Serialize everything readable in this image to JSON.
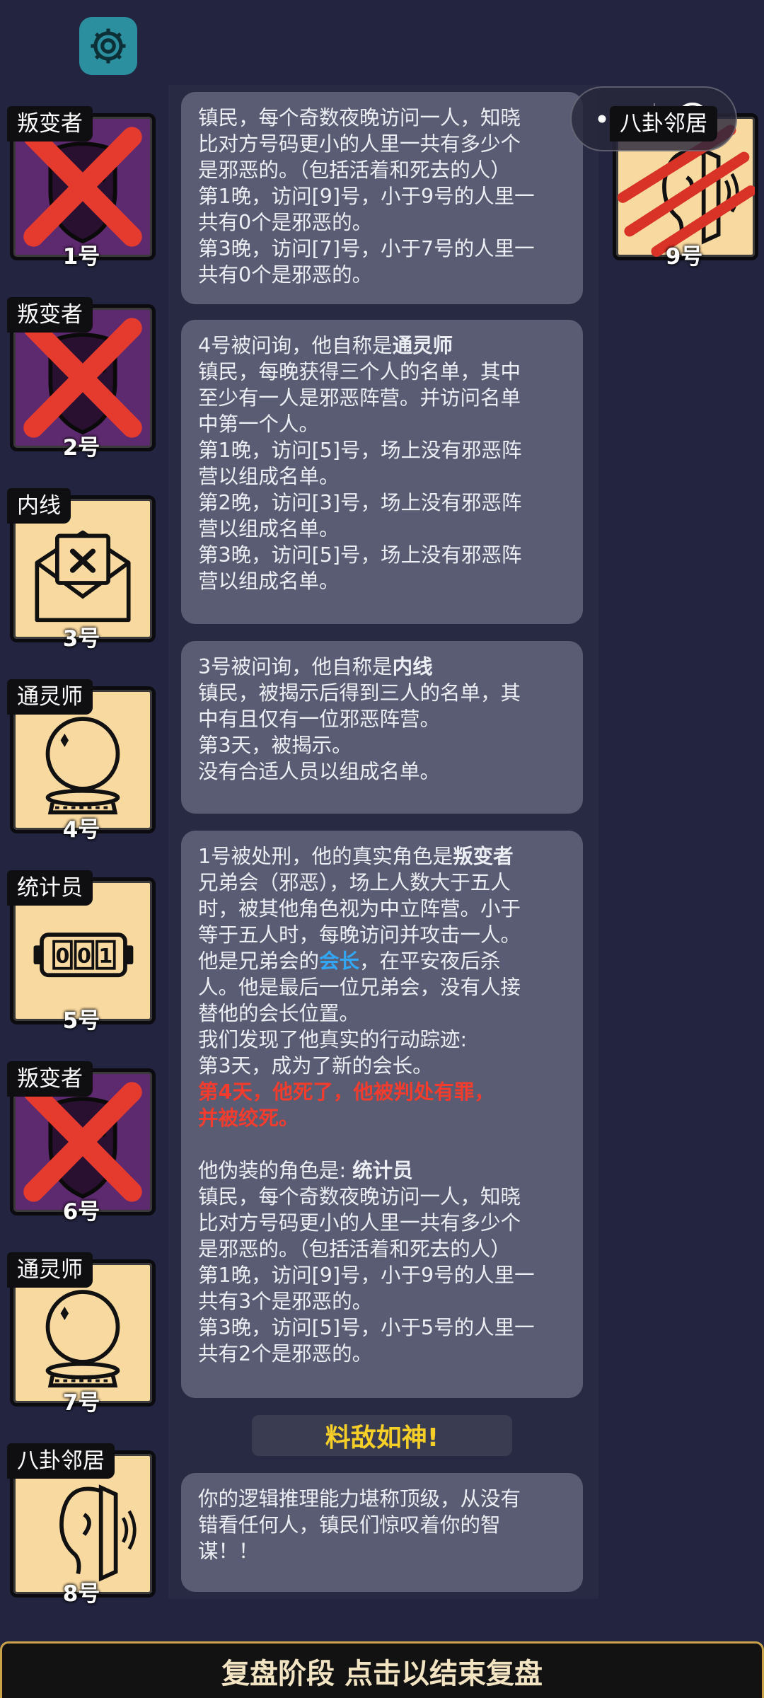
{
  "settings": {
    "icon": "gear-icon"
  },
  "players": [
    {
      "label": "叛变者",
      "number": "1号",
      "style": "purple",
      "dead": true,
      "icon": "mask-icon"
    },
    {
      "label": "叛变者",
      "number": "2号",
      "style": "purple",
      "dead": true,
      "icon": "mask-icon"
    },
    {
      "label": "内线",
      "number": "3号",
      "style": "tan",
      "dead": false,
      "icon": "envelope-icon"
    },
    {
      "label": "通灵师",
      "number": "4号",
      "style": "tan",
      "dead": false,
      "icon": "crystal-ball-icon"
    },
    {
      "label": "统计员",
      "number": "5号",
      "style": "tan",
      "dead": false,
      "icon": "counter-icon"
    },
    {
      "label": "叛变者",
      "number": "6号",
      "style": "purple",
      "dead": true,
      "icon": "mask-icon"
    },
    {
      "label": "通灵师",
      "number": "7号",
      "style": "tan",
      "dead": false,
      "icon": "crystal-ball-icon"
    },
    {
      "label": "八卦邻居",
      "number": "8号",
      "style": "tan",
      "dead": false,
      "icon": "ear-icon"
    },
    {
      "label": "八卦邻居",
      "number": "9号",
      "style": "tan",
      "dead": false,
      "icon": "ear-icon",
      "clawed": true
    }
  ],
  "counter_digits": "001",
  "messages": {
    "m1": [
      "镇民，每个奇数夜晚访问一人，知晓",
      "比对方号码更小的人里一共有多少个",
      "是邪恶的。（包括活着和死去的人）",
      "第1晚，访问[9]号，小于9号的人里一",
      "共有0个是邪恶的。",
      "第3晚，访问[7]号，小于7号的人里一",
      "共有0个是邪恶的。"
    ],
    "m2": {
      "intro": "4号被问询，他自称是",
      "role": "通灵师",
      "lines": [
        "镇民，每晚获得三个人的名单，其中",
        "至少有一人是邪恶阵营。并访问名单",
        "中第一个人。",
        "第1晚，访问[5]号，场上没有邪恶阵",
        "营以组成名单。",
        "第2晚，访问[3]号，场上没有邪恶阵",
        "营以组成名单。",
        "第3晚，访问[5]号，场上没有邪恶阵",
        "营以组成名单。"
      ]
    },
    "m3": {
      "intro": "3号被问询，他自称是",
      "role": "内线",
      "lines": [
        "镇民，被揭示后得到三人的名单，其",
        "中有且仅有一位邪恶阵营。",
        "第3天，被揭示。",
        "没有合适人员以组成名单。"
      ]
    },
    "m4": {
      "intro": "1号被处刑，他的真实角色是",
      "role": "叛变者",
      "lines_a": [
        "兄弟会（邪恶），场上人数大于五人",
        "时，被其他角色视为中立阵营。小于",
        "等于五人时，每晚访问并攻击一人。"
      ],
      "leader_pre": "他是兄弟会的",
      "leader": "会长",
      "leader_post": "，在平安夜后杀",
      "lines_b": [
        "人。他是最后一位兄弟会，没有人接",
        "替他的会长位置。",
        "我们发现了他真实的行动踪迹:",
        "第3天，成为了新的会长。"
      ],
      "death_lines": [
        "第4天，他死了，他被判处有罪，",
        "并被绞死。"
      ],
      "disguise_pre": "他伪装的角色是: ",
      "disguise": "统计员",
      "lines_c": [
        "镇民，每个奇数夜晚访问一人，知晓",
        "比对方号码更小的人里一共有多少个",
        "是邪恶的。（包括活着和死去的人）",
        "第1晚，访问[9]号，小于9号的人里一",
        "共有3个是邪恶的。",
        "第3晚，访问[5]号，小于5号的人里一",
        "共有2个是邪恶的。"
      ]
    },
    "banner": "料敌如神!",
    "m5": [
      "你的逻辑推理能力堪称顶级，从没有",
      "错看任何人，镇民们惊叹着你的智",
      "谋！！"
    ]
  },
  "bottom_bar": "复盘阶段 点击以结束复盘",
  "colors": {
    "accent_blue": "#33a7f5",
    "accent_red": "#f33c2e",
    "banner_gold": "#f5cf27"
  }
}
